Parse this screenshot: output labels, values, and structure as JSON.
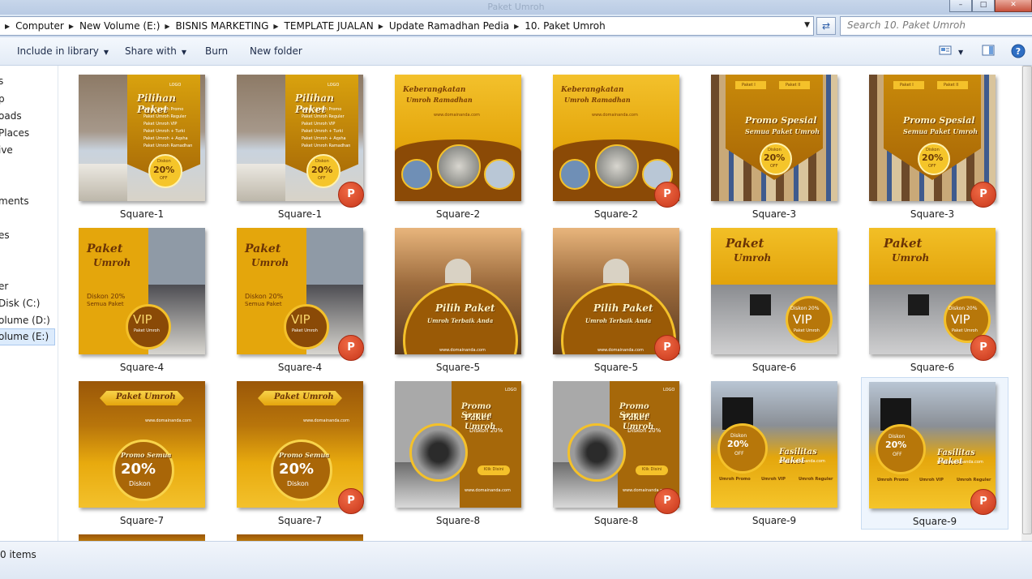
{
  "window": {
    "title": "Paket Umroh"
  },
  "address": {
    "crumbs": [
      "Computer",
      "New Volume (E:)",
      "BISNIS MARKETING",
      "TEMPLATE JUALAN",
      "Update Ramadhan Pedia",
      "10. Paket Umroh"
    ]
  },
  "search": {
    "placeholder": "Search 10. Paket Umroh"
  },
  "toolbar": {
    "include_library": "Include in library",
    "share_with": "Share with",
    "burn": "Burn",
    "new_folder": "New folder"
  },
  "nav": {
    "items": [
      "s",
      "p",
      "oads",
      " Places",
      "ive",
      "ments",
      "es",
      "er",
      "Disk (C:)",
      "olume (D:)",
      "olume (E:)"
    ]
  },
  "files": {
    "names": [
      "Square-1",
      "Square-1",
      "Square-2",
      "Square-2",
      "Square-3",
      "Square-3",
      "Square-4",
      "Square-4",
      "Square-5",
      "Square-5",
      "Square-6",
      "Square-6",
      "Square-7",
      "Square-7",
      "Square-8",
      "Square-8",
      "Square-9",
      "Square-9"
    ]
  },
  "thumb_text": {
    "sq1": {
      "title": "Pilihan Paket",
      "logo": "LOGO",
      "items": [
        "Paket Umroh Promo",
        "Paket Umroh Reguler",
        "Paket Umroh VIP",
        "Paket Umroh + Turki",
        "Paket Umroh + Aqsha",
        "Paket Umroh Ramadhan"
      ],
      "diskon": "Diskon",
      "pct": "20%",
      "off": "OFF"
    },
    "sq2": {
      "title": "Keberangkatan",
      "title2": "Umroh Ramadhan",
      "web": "www.domainanda.com"
    },
    "sq3": {
      "tag1": "Paket I",
      "tag2": "Paket II",
      "title": "Promo Spesial",
      "sub": "Semua Paket Umroh",
      "diskon": "Diskon",
      "pct": "20%",
      "off": "OFF"
    },
    "sq4": {
      "title": "Paket",
      "title2": "Umroh",
      "disc": "Diskon 20%",
      "all": "Semua Paket",
      "vip": "VIP",
      "vsub": "Paket Umroh"
    },
    "sq5": {
      "title": "Pilih Paket",
      "sub": "Umroh Terbaik Anda",
      "web": "www.domainanda.com"
    },
    "sq6": {
      "title": "Paket",
      "title2": "Umroh",
      "disc": "Diskon 20%",
      "vip": "VIP",
      "vsub": "Paket Umroh"
    },
    "sq7": {
      "title": "Paket Umroh",
      "web": "www.domainanda.com",
      "promo": "Promo Semua",
      "pct": "20%",
      "diskon": "Diskon"
    },
    "sq8": {
      "title": "Promo Semua",
      "title2": "Paket Umroh",
      "disc": "Diskon 20%",
      "btn": "Klik Disini",
      "web": "www.domainanda.com",
      "logo": "LOGO"
    },
    "sq9": {
      "diskon": "Diskon",
      "pct": "20%",
      "off": "OFF",
      "title": "Fasilitas Paket",
      "web": "www.domainanda.com",
      "cols": [
        "Umroh Promo",
        "Umroh VIP",
        "Umroh Reguler"
      ]
    }
  },
  "status": {
    "count": "0 items"
  },
  "colors": {
    "gold": "#e6a908",
    "brown": "#8a4a07",
    "ppt": "#d9451f"
  }
}
